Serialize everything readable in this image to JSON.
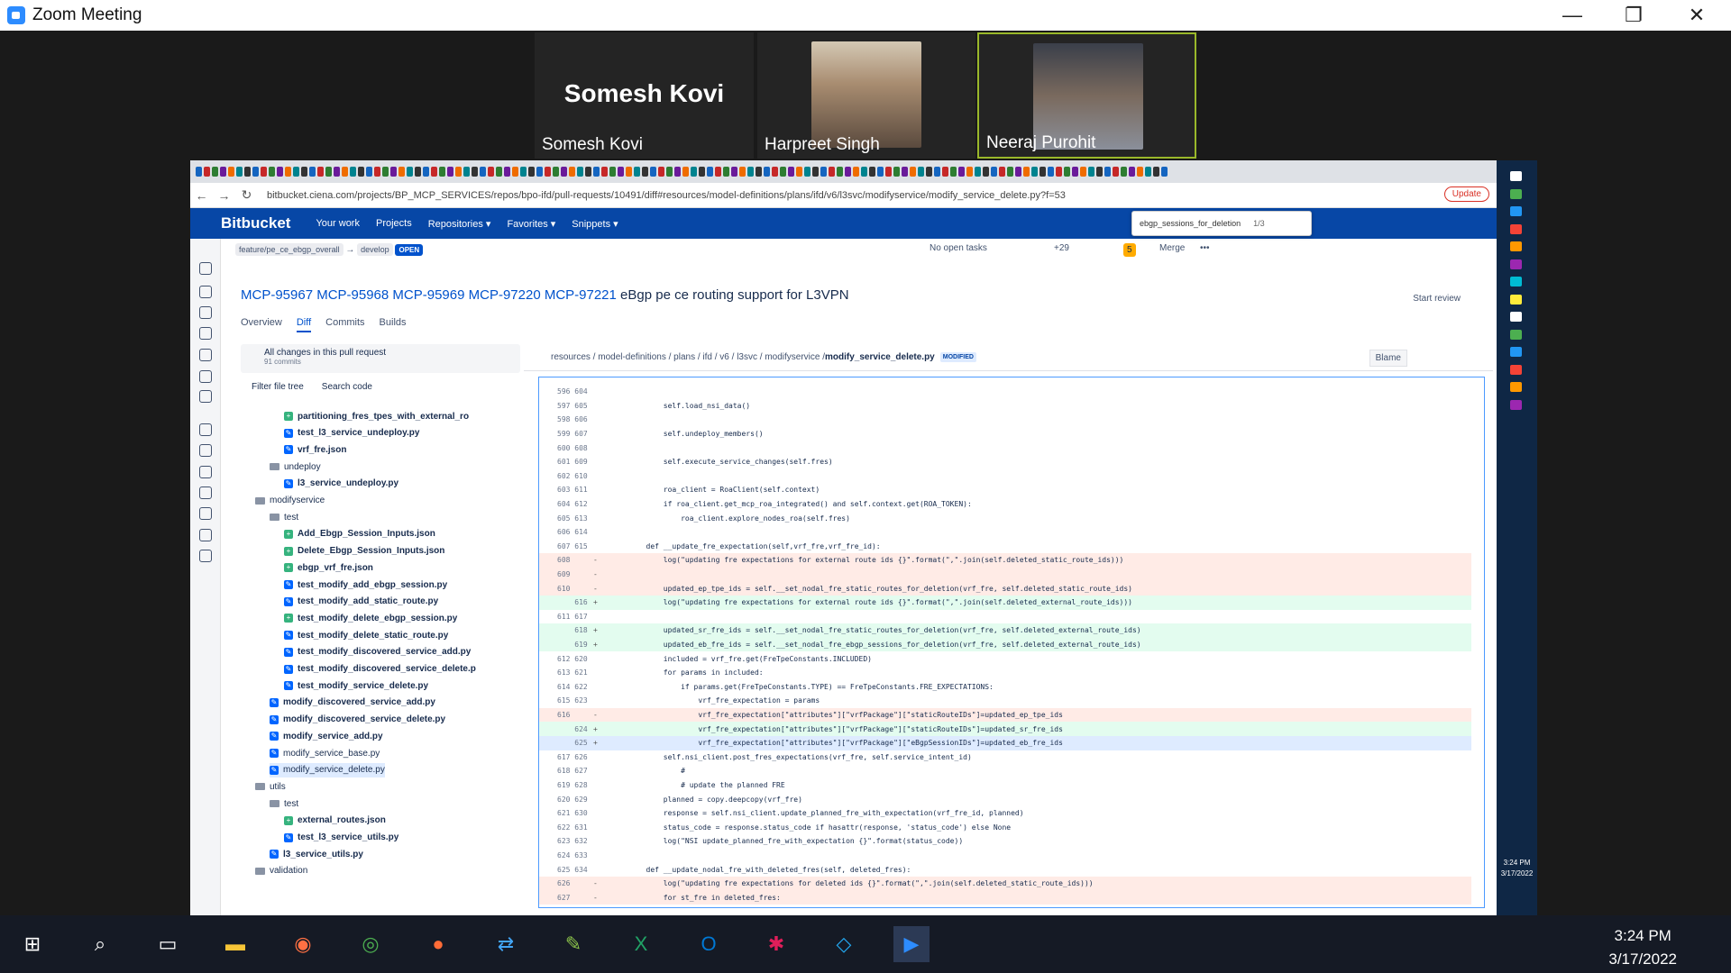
{
  "zoom": {
    "title": "Zoom Meeting",
    "minimize": "—",
    "restore": "❐",
    "close": "✕"
  },
  "participants": [
    {
      "name": "Somesh Kovi",
      "avatar_text": "Somesh Kovi"
    },
    {
      "name": "Harpreet Singh"
    },
    {
      "name": "Neeraj Purohit"
    }
  ],
  "browser": {
    "url": "bitbucket.ciena.com/projects/BP_MCP_SERVICES/repos/bpo-ifd/pull-requests/10491/diff#resources/model-definitions/plans/ifd/v6/l3svc/modifyservice/modify_service_delete.py?f=53",
    "update_label": "Update",
    "find_query": "ebgp_sessions_for_deletion",
    "find_count": "1/3"
  },
  "bitbucket": {
    "logo": "Bitbucket",
    "nav": [
      "Your work",
      "Projects",
      "Repositories ▾",
      "Favorites ▾",
      "Snippets ▾"
    ],
    "source_branch": "feature/pe_ce_ebgp_overall",
    "arrow": "→",
    "target_branch": "develop",
    "status": "OPEN",
    "tasks": "No open tasks",
    "participant_more": "+29",
    "warnings": "5",
    "merge": "Merge",
    "more": "•••",
    "title_links": "MCP-95967 MCP-95968 MCP-95969 MCP-97220 MCP-97221",
    "title_rest": " eBgp pe ce routing support for L3VPN",
    "start_review": "Start review",
    "tabs": [
      "Overview",
      "Diff",
      "Commits",
      "Builds"
    ],
    "changes_label": "All changes in this pull request",
    "commits": "91 commits",
    "filter_tree": "Filter file tree",
    "search_code": "Search code",
    "breadcrumb": "resources / model-definitions / plans / ifd / v6 / l3svc / modifyservice / ",
    "breadcrumb_file": "modify_service_delete.py",
    "modified": "MODIFIED",
    "blame": "Blame"
  },
  "tree": [
    {
      "t": "partitioning_fres_tpes_with_external_ro",
      "k": "a",
      "d": 3
    },
    {
      "t": "test_l3_service_undeploy.py",
      "k": "m",
      "d": 3
    },
    {
      "t": "vrf_fre.json",
      "k": "m",
      "d": 3
    },
    {
      "t": "undeploy",
      "k": "f",
      "d": 2
    },
    {
      "t": "l3_service_undeploy.py",
      "k": "m",
      "d": 3
    },
    {
      "t": "modifyservice",
      "k": "f",
      "d": 1
    },
    {
      "t": "test",
      "k": "f",
      "d": 2
    },
    {
      "t": "Add_Ebgp_Session_Inputs.json",
      "k": "a",
      "d": 3
    },
    {
      "t": "Delete_Ebgp_Session_Inputs.json",
      "k": "a",
      "d": 3
    },
    {
      "t": "ebgp_vrf_fre.json",
      "k": "a",
      "d": 3
    },
    {
      "t": "test_modify_add_ebgp_session.py",
      "k": "m",
      "d": 3
    },
    {
      "t": "test_modify_add_static_route.py",
      "k": "m",
      "d": 3
    },
    {
      "t": "test_modify_delete_ebgp_session.py",
      "k": "a",
      "d": 3
    },
    {
      "t": "test_modify_delete_static_route.py",
      "k": "m",
      "d": 3
    },
    {
      "t": "test_modify_discovered_service_add.py",
      "k": "m",
      "d": 3
    },
    {
      "t": "test_modify_discovered_service_delete.p",
      "k": "m",
      "d": 3
    },
    {
      "t": "test_modify_service_delete.py",
      "k": "m",
      "d": 3
    },
    {
      "t": "modify_discovered_service_add.py",
      "k": "m",
      "d": 2
    },
    {
      "t": "modify_discovered_service_delete.py",
      "k": "m",
      "d": 2
    },
    {
      "t": "modify_service_add.py",
      "k": "m",
      "d": 2
    },
    {
      "t": "modify_service_base.py",
      "k": "m",
      "d": 2
    },
    {
      "t": "modify_service_delete.py",
      "k": "m",
      "d": 2
    },
    {
      "t": "utils",
      "k": "f",
      "d": 1
    },
    {
      "t": "test",
      "k": "f",
      "d": 2
    },
    {
      "t": "external_routes.json",
      "k": "a",
      "d": 3
    },
    {
      "t": "test_l3_service_utils.py",
      "k": "m",
      "d": 3
    },
    {
      "t": "l3_service_utils.py",
      "k": "m",
      "d": 2
    },
    {
      "t": "validation",
      "k": "f",
      "d": 1
    }
  ],
  "code": [
    {
      "o": "596",
      "n": "604",
      "s": "",
      "c": ""
    },
    {
      "o": "597",
      "n": "605",
      "s": "",
      "c": "            self.load_nsi_data()"
    },
    {
      "o": "598",
      "n": "606",
      "s": "",
      "c": ""
    },
    {
      "o": "599",
      "n": "607",
      "s": "",
      "c": "            self.undeploy_members()"
    },
    {
      "o": "600",
      "n": "608",
      "s": "",
      "c": ""
    },
    {
      "o": "601",
      "n": "609",
      "s": "",
      "c": "            self.execute_service_changes(self.fres)"
    },
    {
      "o": "602",
      "n": "610",
      "s": "",
      "c": ""
    },
    {
      "o": "603",
      "n": "611",
      "s": "",
      "c": "            roa_client = RoaClient(self.context)"
    },
    {
      "o": "604",
      "n": "612",
      "s": "",
      "c": "            if roa_client.get_mcp_roa_integrated() and self.context.get(ROA_TOKEN):"
    },
    {
      "o": "605",
      "n": "613",
      "s": "",
      "c": "                roa_client.explore_nodes_roa(self.fres)"
    },
    {
      "o": "606",
      "n": "614",
      "s": "",
      "c": ""
    },
    {
      "o": "607",
      "n": "615",
      "s": "",
      "c": "        def __update_fre_expectation(self,vrf_fre,vrf_fre_id):"
    },
    {
      "o": "608",
      "n": "",
      "s": "-",
      "c": "            log(\"updating fre expectations for external route ids {}\".format(\",\".join(self.deleted_static_route_ids)))",
      "k": "del"
    },
    {
      "o": "609",
      "n": "",
      "s": "-",
      "c": "",
      "k": "del"
    },
    {
      "o": "610",
      "n": "",
      "s": "-",
      "c": "            updated_ep_tpe_ids = self.__set_nodal_fre_static_routes_for_deletion(vrf_fre, self.deleted_static_route_ids)",
      "k": "del"
    },
    {
      "o": "",
      "n": "616",
      "s": "+",
      "c": "            log(\"updating fre expectations for external route ids {}\".format(\",\".join(self.deleted_external_route_ids)))",
      "k": "add"
    },
    {
      "o": "611",
      "n": "617",
      "s": "",
      "c": ""
    },
    {
      "o": "",
      "n": "618",
      "s": "+",
      "c": "            updated_sr_fre_ids = self.__set_nodal_fre_static_routes_for_deletion(vrf_fre, self.deleted_external_route_ids)",
      "k": "add"
    },
    {
      "o": "",
      "n": "619",
      "s": "+",
      "c": "            updated_eb_fre_ids = self.__set_nodal_fre_ebgp_sessions_for_deletion(vrf_fre, self.deleted_external_route_ids)",
      "k": "add"
    },
    {
      "o": "612",
      "n": "620",
      "s": "",
      "c": "            included = vrf_fre.get(FreTpeConstants.INCLUDED)"
    },
    {
      "o": "613",
      "n": "621",
      "s": "",
      "c": "            for params in included:"
    },
    {
      "o": "614",
      "n": "622",
      "s": "",
      "c": "                if params.get(FreTpeConstants.TYPE) == FreTpeConstants.FRE_EXPECTATIONS:"
    },
    {
      "o": "615",
      "n": "623",
      "s": "",
      "c": "                    vrf_fre_expectation = params"
    },
    {
      "o": "616",
      "n": "",
      "s": "-",
      "c": "                    vrf_fre_expectation[\"attributes\"][\"vrfPackage\"][\"staticRouteIDs\"]=updated_ep_tpe_ids",
      "k": "del"
    },
    {
      "o": "",
      "n": "624",
      "s": "+",
      "c": "                    vrf_fre_expectation[\"attributes\"][\"vrfPackage\"][\"staticRouteIDs\"]=updated_sr_fre_ids",
      "k": "add"
    },
    {
      "o": "",
      "n": "625",
      "s": "+",
      "c": "                    vrf_fre_expectation[\"attributes\"][\"vrfPackage\"][\"eBgpSessionIDs\"]=updated_eb_fre_ids",
      "k": "sel"
    },
    {
      "o": "617",
      "n": "626",
      "s": "",
      "c": "            self.nsi_client.post_fres_expectations(vrf_fre, self.service_intent_id)"
    },
    {
      "o": "618",
      "n": "627",
      "s": "",
      "c": "                #"
    },
    {
      "o": "619",
      "n": "628",
      "s": "",
      "c": "                # update the planned FRE"
    },
    {
      "o": "620",
      "n": "629",
      "s": "",
      "c": "            planned = copy.deepcopy(vrf_fre)"
    },
    {
      "o": "621",
      "n": "630",
      "s": "",
      "c": "            response = self.nsi_client.update_planned_fre_with_expectation(vrf_fre_id, planned)"
    },
    {
      "o": "622",
      "n": "631",
      "s": "",
      "c": "            status_code = response.status_code if hasattr(response, 'status_code') else None"
    },
    {
      "o": "623",
      "n": "632",
      "s": "",
      "c": "            log(\"NSI update_planned_fre_with_expectation {}\".format(status_code))"
    },
    {
      "o": "624",
      "n": "633",
      "s": "",
      "c": ""
    },
    {
      "o": "625",
      "n": "634",
      "s": "",
      "c": "        def __update_nodal_fre_with_deleted_fres(self, deleted_fres):"
    },
    {
      "o": "626",
      "n": "",
      "s": "-",
      "c": "            log(\"updating fre expectations for deleted ids {}\".format(\",\".join(self.deleted_static_route_ids)))",
      "k": "del"
    },
    {
      "o": "627",
      "n": "",
      "s": "-",
      "c": "            for st_fre in deleted_fres:",
      "k": "del"
    }
  ],
  "system_tray": {
    "time": "3:24 PM",
    "date": "3/17/2022",
    "mini_time": "3:24 PM",
    "mini_date": "3/17/2022"
  },
  "taskbar_apps": [
    "start-icon",
    "search-icon",
    "task-view-icon",
    "file-explorer-icon",
    "app-icon",
    "chrome-icon",
    "postman-icon",
    "remote-icon",
    "notepad-icon",
    "excel-icon",
    "outlook-icon",
    "slack-icon",
    "vscode-icon",
    "zoom-icon"
  ]
}
